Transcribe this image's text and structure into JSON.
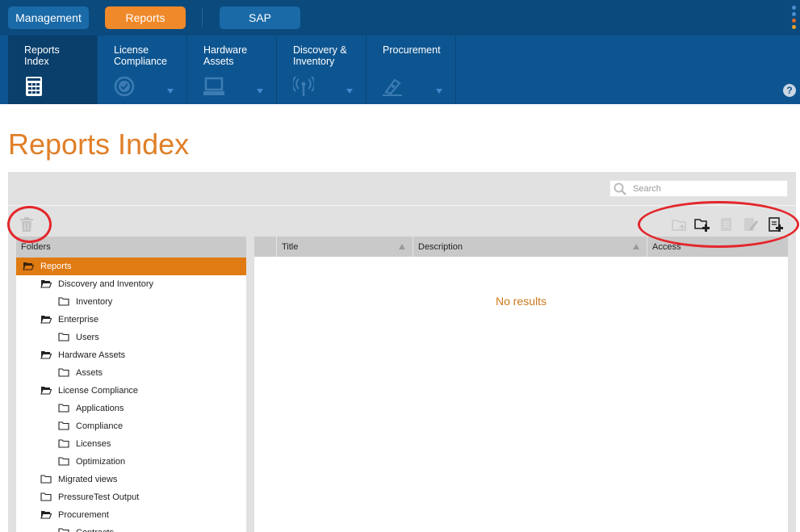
{
  "topbar": {
    "management": "Management",
    "reports": "Reports",
    "sap": "SAP",
    "dot_colors": [
      "#4a8fd0",
      "#4a8fd0",
      "#e2682a",
      "#f0a22a"
    ]
  },
  "nav": {
    "items": [
      {
        "line1": "Reports",
        "line2": "Index",
        "icon": "report-doc-icon",
        "active": true
      },
      {
        "line1": "License",
        "line2": "Compliance",
        "icon": "check-badge-icon"
      },
      {
        "line1": "Hardware",
        "line2": "Assets",
        "icon": "laptop-icon"
      },
      {
        "line1": "Discovery &",
        "line2": "Inventory",
        "icon": "antenna-icon"
      },
      {
        "line1": "Procurement",
        "line2": "",
        "icon": "pen-icon"
      }
    ],
    "help": "?"
  },
  "page_title": "Reports Index",
  "search": {
    "placeholder": "Search"
  },
  "folders": {
    "header": "Folders",
    "items": [
      {
        "label": "Reports",
        "level": 0,
        "open": true,
        "selected": true
      },
      {
        "label": "Discovery and Inventory",
        "level": 1,
        "open": true
      },
      {
        "label": "Inventory",
        "level": 2,
        "open": false
      },
      {
        "label": "Enterprise",
        "level": 1,
        "open": true
      },
      {
        "label": "Users",
        "level": 2,
        "open": false
      },
      {
        "label": "Hardware Assets",
        "level": 1,
        "open": true
      },
      {
        "label": "Assets",
        "level": 2,
        "open": false
      },
      {
        "label": "License Compliance",
        "level": 1,
        "open": true
      },
      {
        "label": "Applications",
        "level": 2,
        "open": false
      },
      {
        "label": "Compliance",
        "level": 2,
        "open": false
      },
      {
        "label": "Licenses",
        "level": 2,
        "open": false
      },
      {
        "label": "Optimization",
        "level": 2,
        "open": false
      },
      {
        "label": "Migrated views",
        "level": 1,
        "open": false
      },
      {
        "label": "PressureTest Output",
        "level": 1,
        "open": false
      },
      {
        "label": "Procurement",
        "level": 1,
        "open": true
      },
      {
        "label": "Contracts",
        "level": 2,
        "open": false
      }
    ]
  },
  "results": {
    "columns": [
      "Title",
      "Description",
      "Access"
    ],
    "empty_text": "No results"
  },
  "colors": {
    "accent": "#e07f28",
    "nav": "#0d5590",
    "annotation": "#e3262b"
  }
}
